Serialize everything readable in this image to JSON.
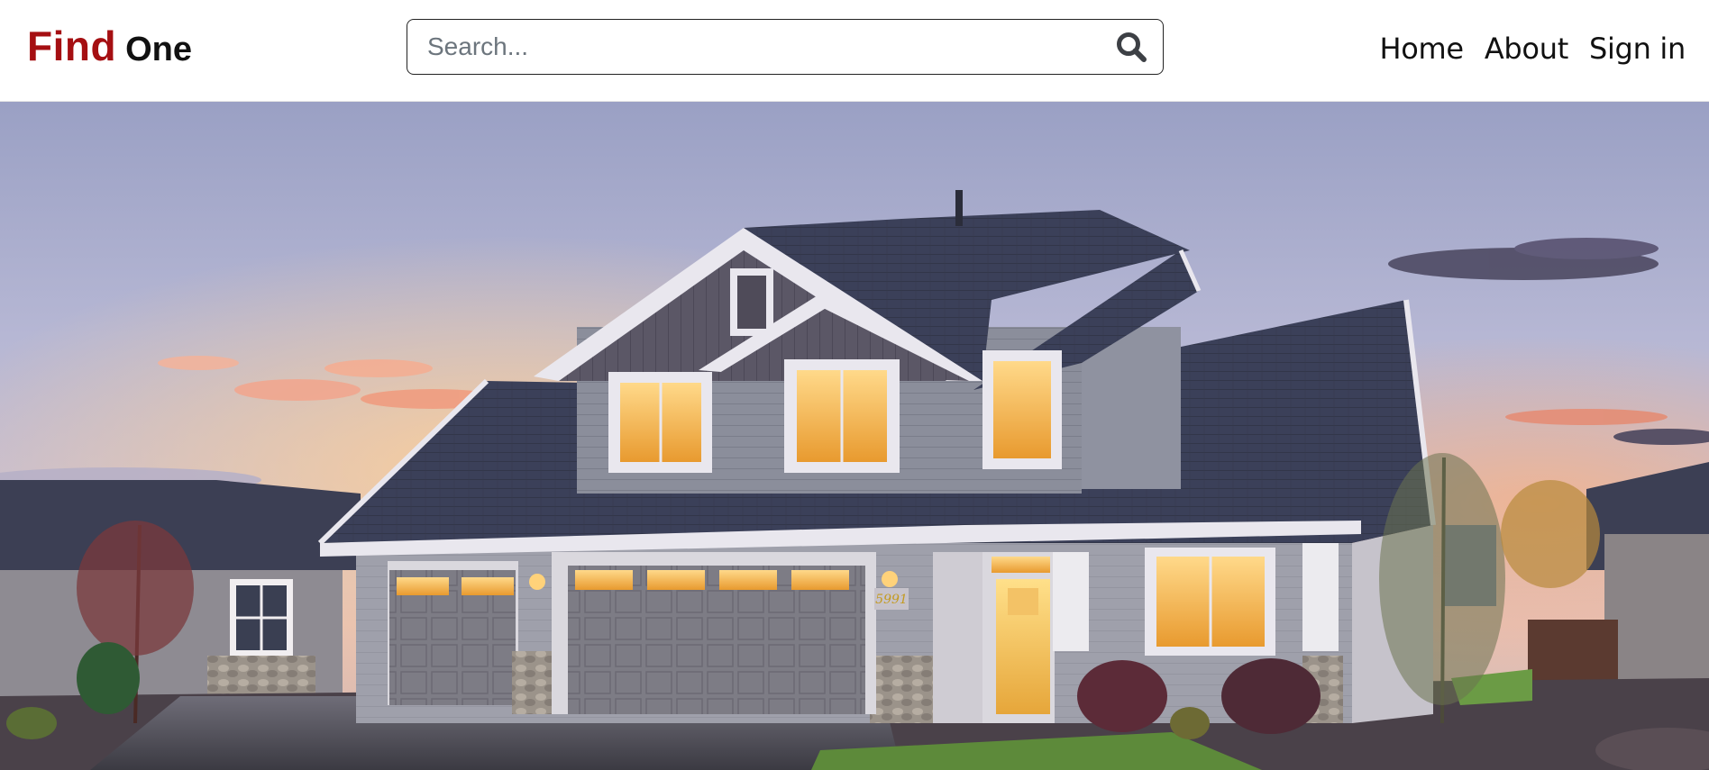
{
  "brand": {
    "first": "Find",
    "second": "One",
    "first_color": "#a50f12",
    "second_color": "#111111"
  },
  "search": {
    "placeholder": "Search...",
    "value": "",
    "icon": "search-icon"
  },
  "nav": {
    "items": [
      {
        "label": "Home"
      },
      {
        "label": "About"
      },
      {
        "label": "Sign in"
      }
    ]
  },
  "hero": {
    "house_number": "5991"
  }
}
